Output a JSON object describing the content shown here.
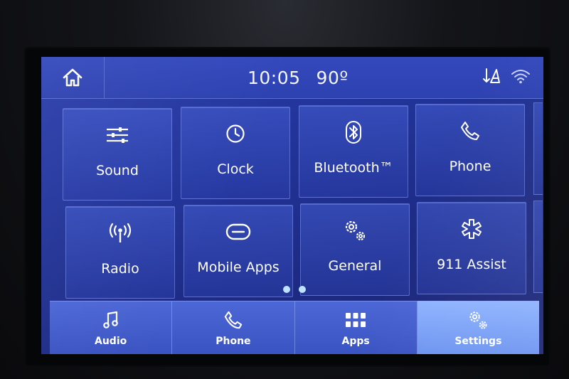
{
  "status_bar": {
    "time": "10:05",
    "temperature": "90º",
    "icons": [
      "home-icon",
      "gps-signal-icon",
      "wifi-icon"
    ]
  },
  "tiles": [
    {
      "label": "Sound",
      "icon": "sliders-icon"
    },
    {
      "label": "Clock",
      "icon": "clock-icon"
    },
    {
      "label": "Bluetooth™",
      "icon": "bluetooth-icon"
    },
    {
      "label": "Phone",
      "icon": "phone-icon"
    },
    {
      "label": "Radio",
      "icon": "radio-antenna-icon"
    },
    {
      "label": "Mobile Apps",
      "icon": "mobile-apps-icon"
    },
    {
      "label": "General",
      "icon": "gears-icon"
    },
    {
      "label": "911 Assist",
      "icon": "star-of-life-icon"
    }
  ],
  "pager": {
    "pages": 2
  },
  "bottom_nav": [
    {
      "label": "Audio",
      "icon": "music-note-icon",
      "active": false
    },
    {
      "label": "Phone",
      "icon": "phone-icon",
      "active": false
    },
    {
      "label": "Apps",
      "icon": "apps-grid-icon",
      "active": false
    },
    {
      "label": "Settings",
      "icon": "gears-icon",
      "active": true
    }
  ],
  "colors": {
    "screen_bg": "#22349a",
    "tile_border": "#8ca5ff",
    "nav_active": "#8fb3ff",
    "text": "#ffffff"
  }
}
